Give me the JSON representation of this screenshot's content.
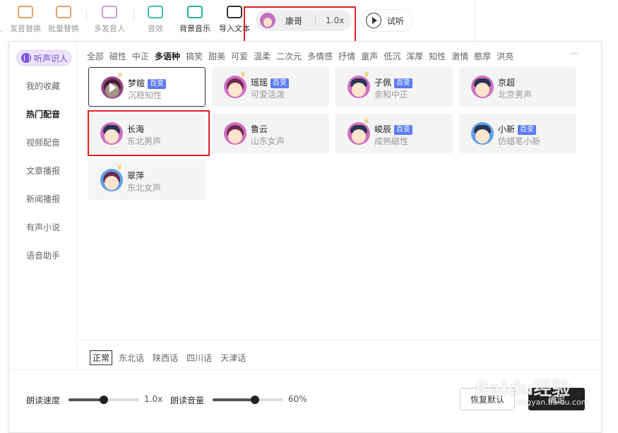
{
  "toolbar": {
    "items": [
      {
        "label": "发音替换",
        "icon": "pronunciation-replace-icon"
      },
      {
        "label": "批量替换",
        "icon": "batch-replace-icon"
      },
      {
        "label": "多发音人",
        "icon": "multi-speaker-icon"
      },
      {
        "label": "音效",
        "icon": "sound-effect-icon"
      },
      {
        "label": "背景音乐",
        "icon": "background-music-icon"
      },
      {
        "label": "导入文本",
        "icon": "import-text-icon"
      }
    ],
    "left_fragment": "替换"
  },
  "current_voice": {
    "name": "康哥",
    "speed": "1.0x"
  },
  "listen_button": "试听",
  "sidebar": {
    "ai_chip": "听声识人",
    "items": [
      "我的收藏",
      "热门配音",
      "视频配音",
      "文章播报",
      "新闻播报",
      "有声小说",
      "语音助手"
    ],
    "active": "热门配音"
  },
  "categories": [
    "全部",
    "磁性",
    "中正",
    "多语种",
    "搞笑",
    "甜美",
    "可爱",
    "温柔",
    "二次元",
    "多情感",
    "抒情",
    "童声",
    "低沉",
    "浑厚",
    "知性",
    "激情",
    "憨厚",
    "洪亮"
  ],
  "active_category": "多语种",
  "more_label": "···",
  "voices": [
    {
      "name": "梦暄",
      "badge": "百变",
      "desc": "沉稳知性",
      "gender": "female",
      "selected": true
    },
    {
      "name": "瑶瑶",
      "badge": "百变",
      "desc": "可爱活泼",
      "gender": "female",
      "selected": false
    },
    {
      "name": "子佩",
      "badge": "百变",
      "desc": "亲和中正",
      "gender": "male",
      "selected": false
    },
    {
      "name": "京超",
      "badge": "",
      "desc": "北京男声",
      "gender": "male",
      "selected": false
    },
    {
      "name": "长海",
      "badge": "",
      "desc": "东北男声",
      "gender": "male",
      "selected": false
    },
    {
      "name": "鲁云",
      "badge": "",
      "desc": "山东女声",
      "gender": "female",
      "selected": false
    },
    {
      "name": "峻辰",
      "badge": "百变",
      "desc": "成熟磁性",
      "gender": "male",
      "selected": false
    },
    {
      "name": "小新",
      "badge": "百变",
      "desc": "仿蜡笔小新",
      "gender": "boy",
      "selected": false
    },
    {
      "name": "翠萍",
      "badge": "",
      "desc": "东北女声",
      "gender": "female",
      "selected": false
    }
  ],
  "dialects": [
    "正常",
    "东北话",
    "陕西话",
    "四川话",
    "天津话"
  ],
  "active_dialect": "正常",
  "controls": {
    "speed_label": "朗读速度",
    "speed_value": "1.0x",
    "speed_fraction": 0.5,
    "volume_label": "朗读音量",
    "volume_value": "60%",
    "volume_fraction": 0.6
  },
  "buttons": {
    "reset": "恢复默认",
    "ok": "确定"
  },
  "watermark": {
    "text": "Baidu经验",
    "sub": "jingyan.baidu.com"
  }
}
